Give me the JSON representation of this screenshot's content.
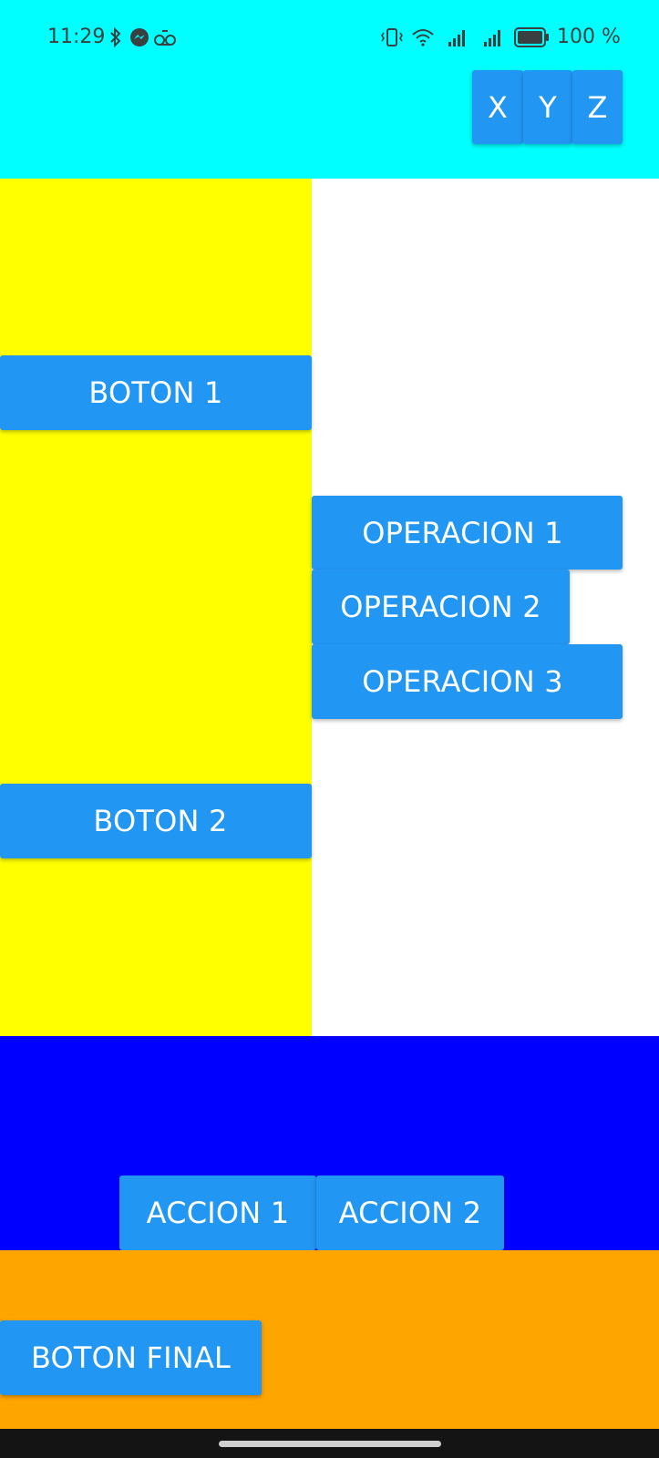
{
  "status_bar": {
    "time": "11:29",
    "battery": "100 %",
    "icons": [
      "bluetooth-icon",
      "messenger-icon",
      "voicemail-icon",
      "vibrate-icon",
      "wifi-icon",
      "signal-icon",
      "signal-icon",
      "battery-icon"
    ]
  },
  "toolbar": {
    "buttons": [
      "X",
      "Y",
      "Z"
    ]
  },
  "left_panel": {
    "buttons": [
      "BOTON 1",
      "BOTON 2"
    ]
  },
  "right_panel": {
    "buttons": [
      "OPERACION 1",
      "OPERACION 2",
      "OPERACION 3"
    ]
  },
  "action_bar": {
    "buttons": [
      "ACCION 1",
      "ACCION 2"
    ]
  },
  "footer": {
    "button": "BOTON FINAL"
  },
  "colors": {
    "top_background": "#00ffff",
    "left_panel_background": "#ffff00",
    "right_panel_background": "#ffffff",
    "action_background": "#0000ff",
    "footer_background": "#ffa500",
    "button": "#2196f3"
  }
}
